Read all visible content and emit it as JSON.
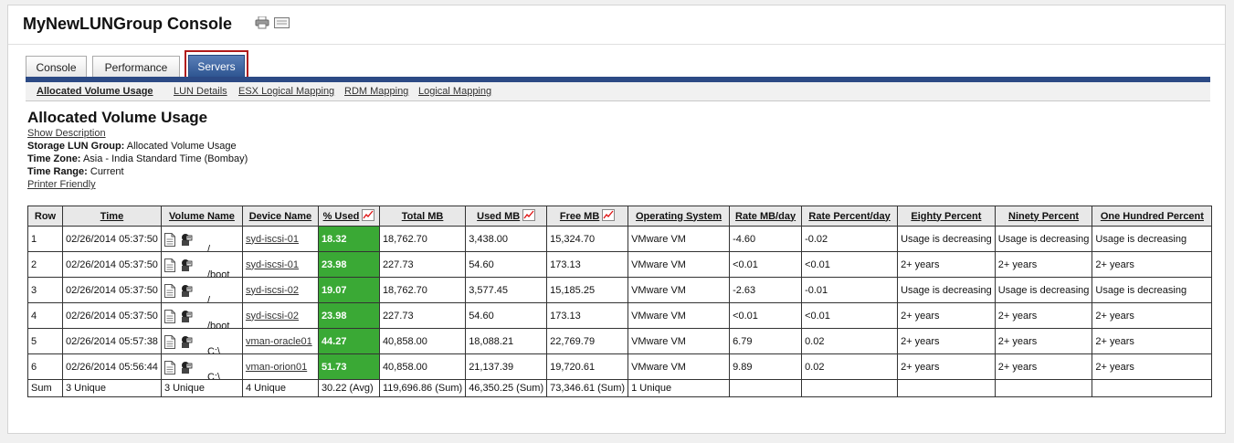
{
  "header": {
    "title": "MyNewLUNGroup Console"
  },
  "tabs": [
    {
      "label": "Console"
    },
    {
      "label": "Performance"
    },
    {
      "label": "Servers"
    }
  ],
  "subnav": [
    {
      "label": "Allocated Volume Usage"
    },
    {
      "label": "LUN Details"
    },
    {
      "label": "ESX Logical Mapping"
    },
    {
      "label": "RDM Mapping"
    },
    {
      "label": "Logical Mapping"
    }
  ],
  "page": {
    "title": "Allocated Volume Usage",
    "show_description": "Show Description",
    "storage_lun_group_label": "Storage LUN Group:",
    "storage_lun_group_value": "Allocated Volume Usage",
    "time_zone_label": "Time Zone:",
    "time_zone_value": "Asia - India Standard Time (Bombay)",
    "time_range_label": "Time Range:",
    "time_range_value": "Current",
    "printer_friendly": "Printer Friendly"
  },
  "table": {
    "columns": [
      "Row",
      "Time",
      "Volume Name",
      "Device Name",
      "% Used",
      "Total MB",
      "Used MB",
      "Free MB",
      "Operating System",
      "Rate MB/day",
      "Rate Percent/day",
      "Eighty Percent",
      "Ninety Percent",
      "One Hundred Percent"
    ],
    "rows": [
      [
        "1",
        "02/26/2014 05:37:50",
        "/",
        "syd-iscsi-01",
        "18.32",
        "18,762.70",
        "3,438.00",
        "15,324.70",
        "VMware VM",
        "-4.60",
        "-0.02",
        "Usage is decreasing",
        "Usage is decreasing",
        "Usage is decreasing"
      ],
      [
        "2",
        "02/26/2014 05:37:50",
        "/boot",
        "syd-iscsi-01",
        "23.98",
        "227.73",
        "54.60",
        "173.13",
        "VMware VM",
        "<0.01",
        "<0.01",
        "2+ years",
        "2+ years",
        "2+ years"
      ],
      [
        "3",
        "02/26/2014 05:37:50",
        "/",
        "syd-iscsi-02",
        "19.07",
        "18,762.70",
        "3,577.45",
        "15,185.25",
        "VMware VM",
        "-2.63",
        "-0.01",
        "Usage is decreasing",
        "Usage is decreasing",
        "Usage is decreasing"
      ],
      [
        "4",
        "02/26/2014 05:37:50",
        "/boot",
        "syd-iscsi-02",
        "23.98",
        "227.73",
        "54.60",
        "173.13",
        "VMware VM",
        "<0.01",
        "<0.01",
        "2+ years",
        "2+ years",
        "2+ years"
      ],
      [
        "5",
        "02/26/2014 05:57:38",
        "C:\\",
        "vman-oracle01",
        "44.27",
        "40,858.00",
        "18,088.21",
        "22,769.79",
        "VMware VM",
        "6.79",
        "0.02",
        "2+ years",
        "2+ years",
        "2+ years"
      ],
      [
        "6",
        "02/26/2014 05:56:44",
        "C:\\",
        "vman-orion01",
        "51.73",
        "40,858.00",
        "21,137.39",
        "19,720.61",
        "VMware VM",
        "9.89",
        "0.02",
        "2+ years",
        "2+ years",
        "2+ years"
      ]
    ],
    "sum": [
      "Sum",
      "3 Unique",
      "3 Unique",
      "4 Unique",
      "30.22 (Avg)",
      "119,696.86 (Sum)",
      "46,350.25 (Sum)",
      "73,346.61 (Sum)",
      "1 Unique",
      "",
      "",
      "",
      "",
      ""
    ]
  },
  "colors": {
    "accent_bar": "#2c4a85",
    "used_cell": "#3aa935",
    "active_tab": "#2e5591",
    "tab_highlight_border": "#b01a1a"
  }
}
